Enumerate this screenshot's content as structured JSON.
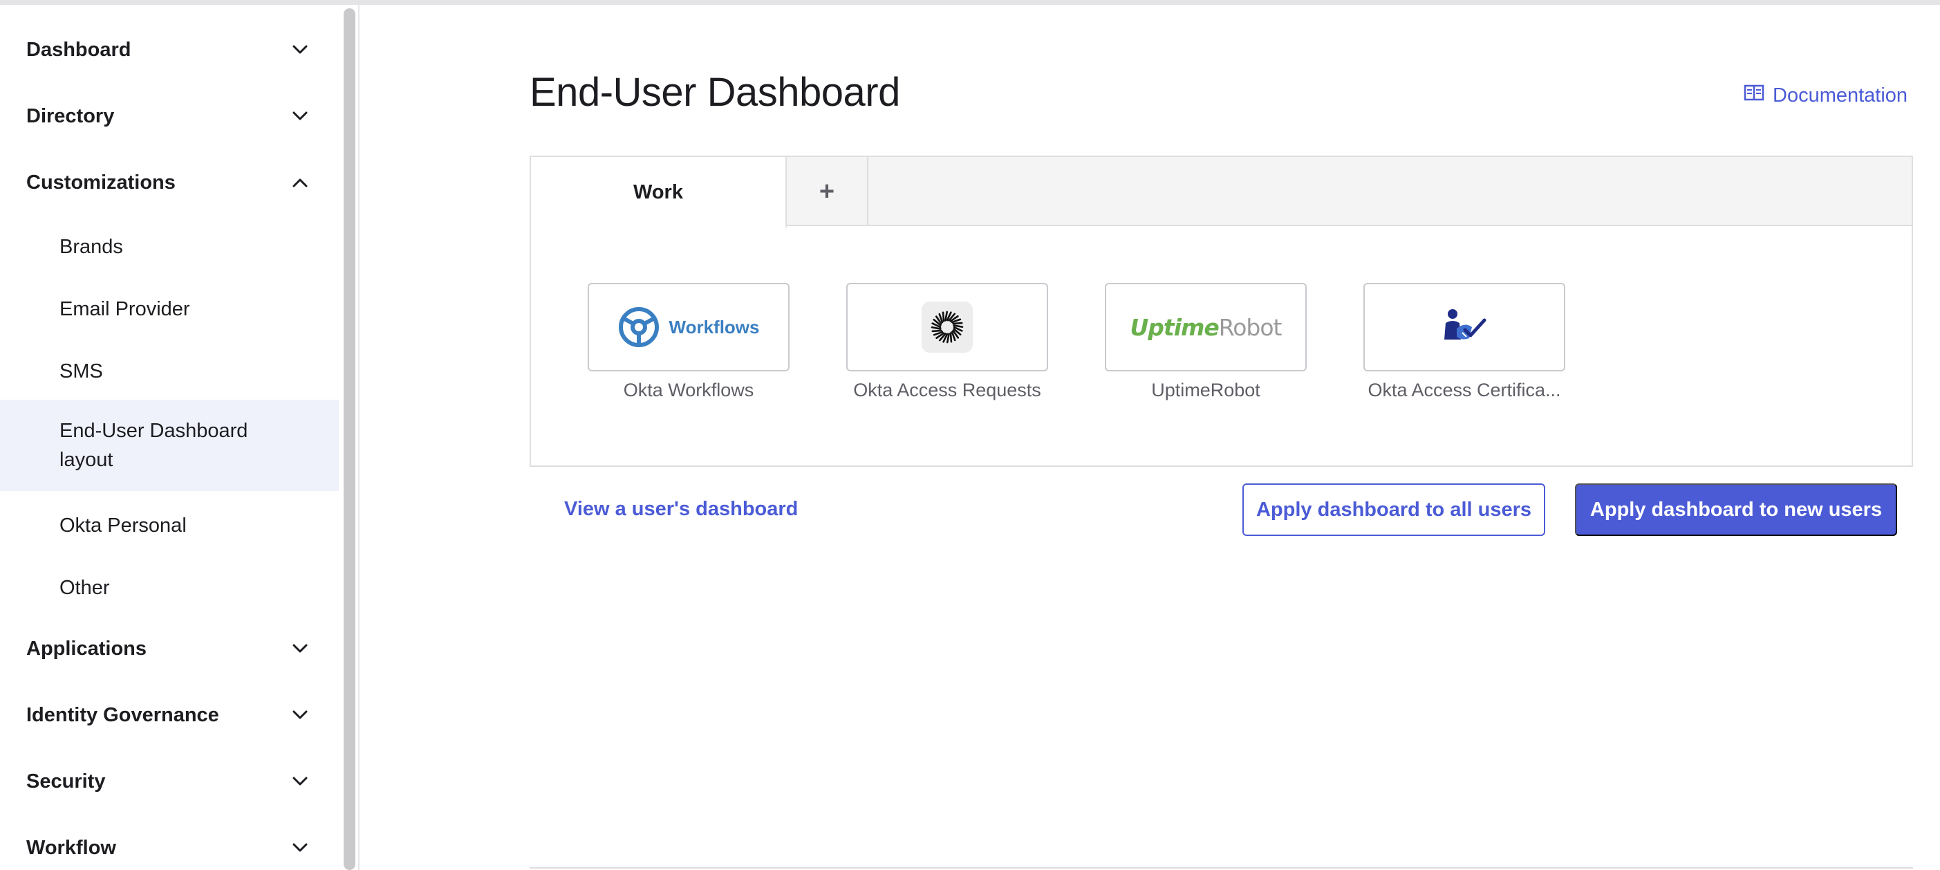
{
  "sidebar": {
    "sections": [
      {
        "label": "Dashboard",
        "expanded": false
      },
      {
        "label": "Directory",
        "expanded": false
      },
      {
        "label": "Customizations",
        "expanded": true
      },
      {
        "label": "Applications",
        "expanded": false
      },
      {
        "label": "Identity Governance",
        "expanded": false
      },
      {
        "label": "Security",
        "expanded": false
      },
      {
        "label": "Workflow",
        "expanded": false
      }
    ],
    "customizations_items": [
      {
        "label": "Brands"
      },
      {
        "label": "Email Provider"
      },
      {
        "label": "SMS"
      },
      {
        "label": "End-User Dashboard layout",
        "active": true
      },
      {
        "label": "Okta Personal"
      },
      {
        "label": "Other"
      }
    ]
  },
  "main": {
    "title": "End-User Dashboard",
    "documentation_label": "Documentation",
    "tabs": [
      {
        "label": "Work",
        "selected": true
      },
      {
        "label": "+"
      }
    ],
    "apps": [
      {
        "name": "Okta Workflows",
        "logo_text": "Workflows",
        "logo": "workflows-logo"
      },
      {
        "name": "Okta Access Requests",
        "logo": "access-requests-logo"
      },
      {
        "name": "UptimeRobot",
        "logo_text_a": "Uptime",
        "logo_text_b": "Robot",
        "logo": "uptimerobot-logo"
      },
      {
        "name": "Okta Access Certifica...",
        "logo": "access-certifications-logo"
      }
    ],
    "view_user_dashboard": "View a user's dashboard",
    "apply_all_label": "Apply dashboard to all users",
    "apply_new_label": "Apply dashboard to new users"
  },
  "colors": {
    "accent": "#4b5bd6",
    "active_bg": "#eff1fb",
    "workflows_blue": "#3a7fc1",
    "uptime_green": "#6ab04c"
  }
}
